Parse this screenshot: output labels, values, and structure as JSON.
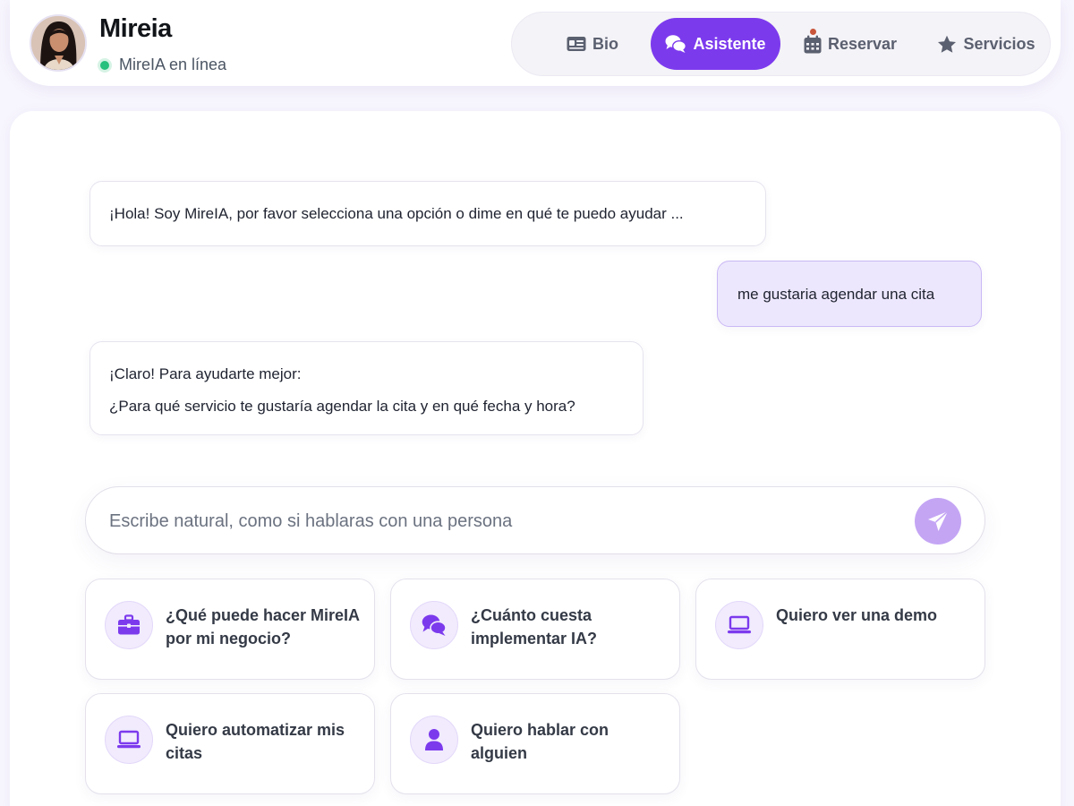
{
  "profile": {
    "name": "Mireia",
    "status": "MireIA en línea",
    "status_color": "#27c07c"
  },
  "nav": {
    "items": [
      {
        "label": "Bio",
        "icon": "id-card-icon",
        "active": false
      },
      {
        "label": "Asistente",
        "icon": "chat-bubbles-icon",
        "active": true
      },
      {
        "label": "Reservar",
        "icon": "calendar-icon",
        "active": false,
        "notification": true
      },
      {
        "label": "Servicios",
        "icon": "star-icon",
        "active": false
      }
    ]
  },
  "chat": {
    "messages": [
      {
        "sender": "assistant",
        "lines": [
          "¡Hola! Soy MireIA, por favor selecciona una opción o dime en qué te puedo ayudar ..."
        ]
      },
      {
        "sender": "user",
        "lines": [
          "me gustaria agendar una cita"
        ]
      },
      {
        "sender": "assistant",
        "lines": [
          "¡Claro! Para ayudarte mejor:",
          "¿Para qué servicio te gustaría agendar la cita y en qué fecha y hora?"
        ]
      }
    ]
  },
  "input": {
    "placeholder": "Escribe natural, como si hablaras con una persona",
    "value": ""
  },
  "suggestions": [
    {
      "label": "¿Qué puede hacer MireIA por mi negocio?",
      "icon": "briefcase-icon"
    },
    {
      "label": "¿Cuánto cuesta implementar IA?",
      "icon": "chat-bubbles-icon"
    },
    {
      "label": "Quiero ver una demo",
      "icon": "laptop-icon"
    },
    {
      "label": "Quiero automatizar mis citas",
      "icon": "laptop-icon"
    },
    {
      "label": "Quiero hablar con alguien",
      "icon": "user-icon"
    }
  ],
  "colors": {
    "accent": "#7c3aed",
    "user_bubble": "#ede7fd",
    "send_button": "#c4a5f4",
    "background": "#f7f5fd"
  }
}
